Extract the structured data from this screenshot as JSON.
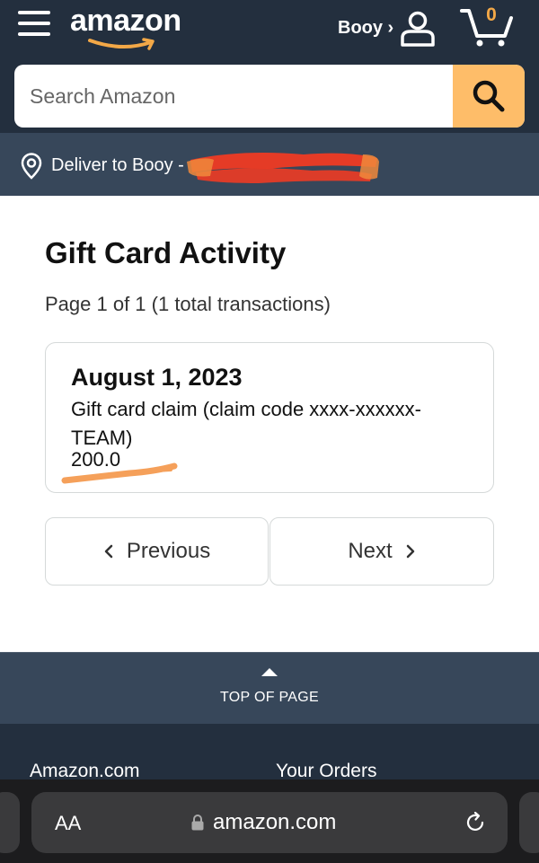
{
  "header": {
    "logo": "amazon",
    "account_label": "Booy ›",
    "cart_count": "0"
  },
  "search": {
    "placeholder": "Search Amazon"
  },
  "deliver": {
    "label": "Deliver to Booy -"
  },
  "main": {
    "title": "Gift Card Activity",
    "page_info": "Page 1 of 1 (1 total transactions)",
    "transaction": {
      "date": "August 1, 2023",
      "description": "Gift card claim (claim code xxxx-xxxxxx-TEAM)",
      "amount": "200.0"
    },
    "pager": {
      "previous": "Previous",
      "next": "Next"
    }
  },
  "back_to_top": {
    "label": "TOP OF PAGE"
  },
  "footer": {
    "links": [
      "Amazon.com",
      "Your Orders"
    ]
  },
  "browser": {
    "text_size": "AA",
    "url": "amazon.com"
  },
  "colors": {
    "header_bg": "#232f3e",
    "subheader_bg": "#37475a",
    "search_button": "#febd69",
    "logo_smile": "#f3a847",
    "annotation_orange": "#f5a05a",
    "redaction_red": "#ee3b24"
  },
  "icons": [
    "menu-icon",
    "user-icon",
    "cart-icon",
    "search-icon",
    "location-pin-icon",
    "chevron-left-icon",
    "chevron-right-icon",
    "caret-up-icon",
    "lock-icon",
    "reload-icon"
  ]
}
